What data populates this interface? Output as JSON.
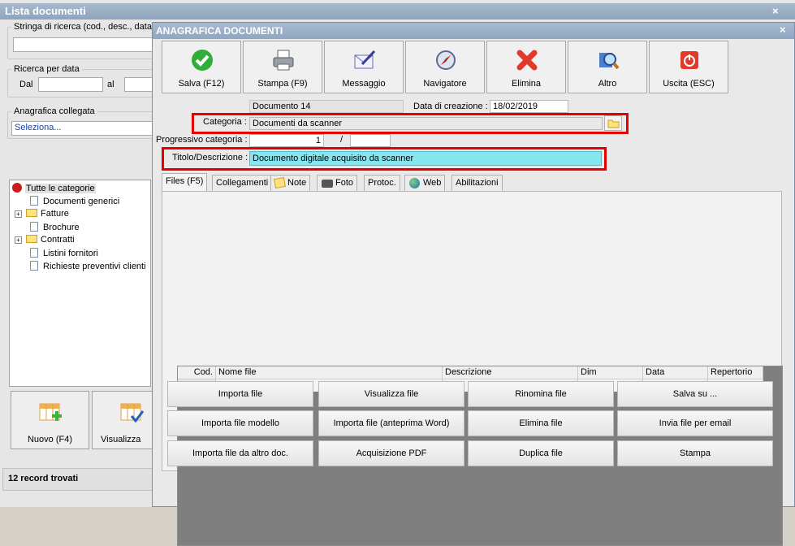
{
  "back": {
    "title": "Lista documenti",
    "search_label": "Stringa di ricerca (cod., desc., data",
    "date_group_label": "Ricerca per data",
    "date_from_label": "Dal",
    "date_to_label": "al",
    "linked_label": "Anagrafica collegata",
    "linked_value": "Seleziona...",
    "tree": {
      "root": "Tutte le categorie",
      "items": [
        "Documenti generici",
        "Fatture",
        "Brochure",
        "Contratti",
        "Listini fornitori",
        "Richieste preventivi clienti"
      ]
    },
    "new_button": "Nuovo (F4)",
    "view_button": "Visualizza",
    "status": "12 record trovati"
  },
  "dialog": {
    "title": "ANAGRAFICA DOCUMENTI",
    "toolbar": [
      "Salva (F12)",
      "Stampa (F9)",
      "Messaggio",
      "Navigatore",
      "Elimina",
      "Altro",
      "Uscita (ESC)"
    ],
    "doc_number": "Documento 14",
    "creation_date_label": "Data di creazione :",
    "creation_date": "18/02/2019",
    "category_label": "Categoria :",
    "category_value": "Documenti da scanner",
    "progressive_label": "Progressivo categoria :",
    "progressive_value": "1",
    "progressive_sep": "/",
    "title_label": "Titolo/Descrizione :",
    "title_value": "Documento digitale acquisito da scanner",
    "tabs": [
      "Files (F5)",
      "Collegamenti",
      "Note",
      "Foto",
      "Protoc.",
      "Web",
      "Abilitazioni"
    ],
    "grid_headers": [
      "Cod.",
      "Nome file",
      "Descrizione",
      "Dim",
      "Data",
      "Repertorio"
    ],
    "actions": [
      [
        "Importa file",
        "Visualizza file",
        "Rinomina file",
        "Salva su ..."
      ],
      [
        "Importa file modello",
        "Importa file (anteprima Word)",
        "Elimina file",
        "Invia file per email"
      ],
      [
        "Importa file da altro doc.",
        "Acquisizione PDF",
        "Duplica file",
        "Stampa"
      ]
    ]
  },
  "colors": {
    "highlight_field": "#86e6ef",
    "red_box": "#e30000",
    "title_bar": "#8ea5bd"
  }
}
